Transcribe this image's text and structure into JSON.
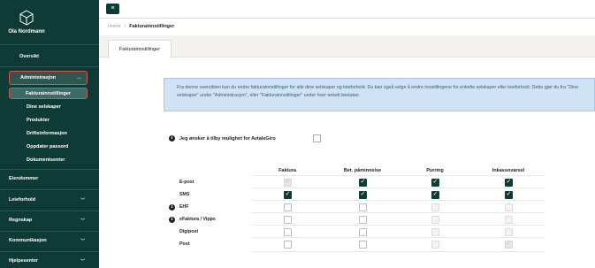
{
  "sidebar": {
    "user_name": "Ola Nordmann",
    "overview": "Oversikt",
    "admin_label": "Administrasjon",
    "admin_subitems": [
      "Fakturainnstillinger",
      "Dine selskaper",
      "Produkter",
      "Driftsinformasjon",
      "Oppdater passord",
      "Dokumentsenter"
    ],
    "sections": [
      "Eiendommer",
      "Leieforhold",
      "Regnskap",
      "Kommunikasjon",
      "Hjelpesenter"
    ]
  },
  "breadcrumb": {
    "home": "Home",
    "separator": "/",
    "current": "Fakturainnstillinger"
  },
  "tab": {
    "label": "Fakturainnstillinger"
  },
  "info_text": "Fra denne oversikten kan du endre fakturainnstillinger for alle dine selskaper og leieforhold. Du kan også velge å endre innstillingene for enkelte selskaper eller leieforhold. Dette gjør du fra \"Dine selskaper\" under \"Administrasjon\", eller \"Fakturainnstillinger\" under hver enkelt leietaker.",
  "avtalegiro_label": "Jeg ønsker å tilby mulighet for AvtaleGiro",
  "table": {
    "columns": [
      "Faktura",
      "Bet. påminnelse",
      "Purring",
      "Inkassovarsel"
    ],
    "rows": [
      {
        "label": "E-post",
        "info": false,
        "cells": [
          "disabled-checked",
          "checked",
          "checked",
          "checked"
        ]
      },
      {
        "label": "SMS",
        "info": false,
        "cells": [
          "checked",
          "checked",
          "checked",
          "checked"
        ]
      },
      {
        "label": "EHF",
        "info": true,
        "cells": [
          "empty",
          "empty",
          "disabled",
          "disabled"
        ]
      },
      {
        "label": "eFaktura / Vipps",
        "info": true,
        "cells": [
          "empty",
          "empty",
          "disabled",
          "disabled"
        ]
      },
      {
        "label": "Digipost",
        "info": false,
        "cells": [
          "empty",
          "empty",
          "disabled",
          "disabled"
        ]
      },
      {
        "label": "Post",
        "info": false,
        "cells": [
          "empty",
          "empty",
          "disabled",
          "disabled-checked"
        ]
      }
    ]
  }
}
